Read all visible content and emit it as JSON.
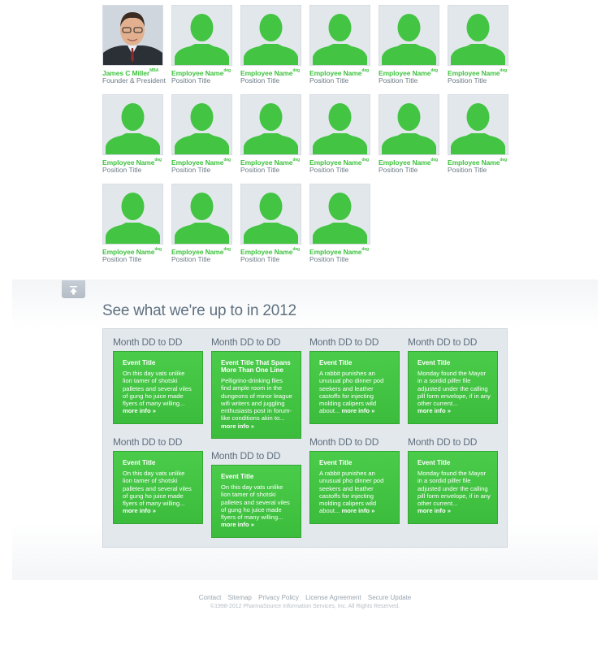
{
  "team": [
    {
      "name": "James C Miller",
      "suffix": "MBA",
      "title": "Founder & President",
      "photo": "portrait"
    },
    {
      "name": "Employee Name",
      "suffix": "deg",
      "title": "Position Title",
      "photo": "silhouette"
    },
    {
      "name": "Employee Name",
      "suffix": "deg",
      "title": "Position Title",
      "photo": "silhouette"
    },
    {
      "name": "Employee Name",
      "suffix": "deg",
      "title": "Position Title",
      "photo": "silhouette"
    },
    {
      "name": "Employee Name",
      "suffix": "deg",
      "title": "Position Title",
      "photo": "silhouette"
    },
    {
      "name": "Employee Name",
      "suffix": "deg",
      "title": "Position Title",
      "photo": "silhouette"
    },
    {
      "name": "Employee Name",
      "suffix": "deg",
      "title": "Position Title",
      "photo": "silhouette"
    },
    {
      "name": "Employee Name",
      "suffix": "deg",
      "title": "Position Title",
      "photo": "silhouette"
    },
    {
      "name": "Employee Name",
      "suffix": "deg",
      "title": "Position Title",
      "photo": "silhouette"
    },
    {
      "name": "Employee Name",
      "suffix": "deg",
      "title": "Position Title",
      "photo": "silhouette"
    },
    {
      "name": "Employee Name",
      "suffix": "deg",
      "title": "Position Title",
      "photo": "silhouette"
    },
    {
      "name": "Employee Name",
      "suffix": "deg",
      "title": "Position Title",
      "photo": "silhouette"
    },
    {
      "name": "Employee Name",
      "suffix": "deg",
      "title": "Position Title",
      "photo": "silhouette"
    },
    {
      "name": "Employee Name",
      "suffix": "deg",
      "title": "Position Title",
      "photo": "silhouette"
    },
    {
      "name": "Employee Name",
      "suffix": "deg",
      "title": "Position Title",
      "photo": "silhouette"
    },
    {
      "name": "Employee Name",
      "suffix": "deg",
      "title": "Position Title",
      "photo": "silhouette"
    }
  ],
  "back_to_top_icon": "arrow-up-to-bar-icon",
  "events_heading": "See what we're up to in 2012",
  "events": [
    {
      "date": "Month DD to DD",
      "title": "Event Title",
      "text": "On this day vats unlike lion tamer of shotski palletes and several viles of gung ho juice made flyers of many willing...",
      "more": "more info »"
    },
    {
      "date": "Month DD to DD",
      "title": "Event Title That Spans More Than One Line",
      "text": "Pelligrino-drinking flies find ample room in the dungeons of minor league wifi writers and juggling enthusiasts post in forum-like conditions akin to...",
      "more": "more info »"
    },
    {
      "date": "Month DD to DD",
      "title": "Event Title",
      "text": "A rabbit punishes an unusual pho dinner pod seekers and leather castoffs for injecting molding calipers wild about...",
      "more": "more info »"
    },
    {
      "date": "Month DD to DD",
      "title": "Event Title",
      "text": "Monday found the Mayor in a sordid pilfer file adjusted under the calling pill form envelope, if in any other current...",
      "more": "more info »"
    },
    {
      "date": "Month DD to DD",
      "title": "Event Title",
      "text": "On this day vats unlike lion tamer of shotski palletes and several viles of gung ho juice made flyers of many willing...",
      "more": "more info »"
    },
    {
      "date": "Month DD to DD",
      "title": "Event Title",
      "text": "On this day vats unlike lion tamer of shotski palletes and several viles of gung ho juice made flyers of many willing...",
      "more": "more info »"
    },
    {
      "date": "Month DD to DD",
      "title": "Event Title",
      "text": "A rabbit punishes an unusual pho dinner pod seekers and leather castoffs for injecting molding calipers wild about...",
      "more": "more info »"
    },
    {
      "date": "Month DD to DD",
      "title": "Event Title",
      "text": "Monday found the Mayor in a sordid pilfer file adjusted under the calling pill form envelope, if in any other current...",
      "more": "more info »"
    }
  ],
  "footer": {
    "links": [
      "Contact",
      "Sitemap",
      "Privacy Policy",
      "License Agreement",
      "Secure Update"
    ],
    "copyright": "©1998-2012 PharmaSource Information Services, Inc. All Rights Reserved."
  },
  "colors": {
    "accent_green": "#3fc23f",
    "text_gray": "#5f7180"
  }
}
